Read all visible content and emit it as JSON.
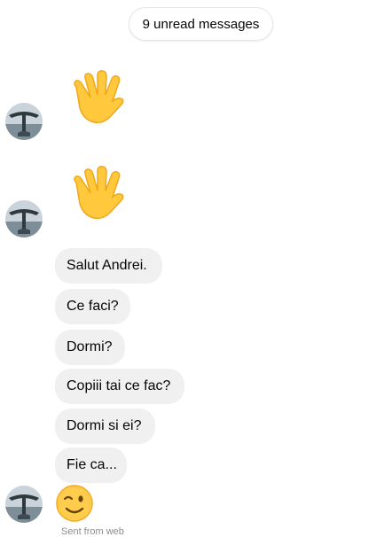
{
  "header": {
    "unread_label": "9 unread messages"
  },
  "messages": [
    {
      "type": "emoji",
      "emoji": "waving-hand"
    },
    {
      "type": "emoji",
      "emoji": "waving-hand"
    },
    {
      "type": "text",
      "text": "Salut Andrei."
    },
    {
      "type": "text",
      "text": "Ce faci?"
    },
    {
      "type": "text",
      "text": "Dormi?"
    },
    {
      "type": "text",
      "text": "Copiii tai ce fac?"
    },
    {
      "type": "text",
      "text": "Dormi si ei?"
    },
    {
      "type": "text",
      "text": "Fie ca..."
    },
    {
      "type": "emoji",
      "emoji": "winking-face"
    }
  ],
  "footer": {
    "sent_label": "Sent from web"
  },
  "colors": {
    "bubble": "#f0f0f0",
    "text": "#050505",
    "muted": "#8a8d91"
  }
}
